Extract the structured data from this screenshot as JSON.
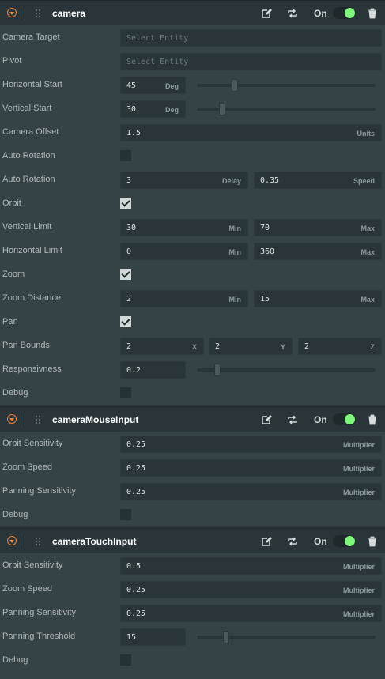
{
  "header_common": {
    "on_label": "On"
  },
  "camera": {
    "title": "camera",
    "camera_target": {
      "label": "Camera Target",
      "placeholder": "Select Entity"
    },
    "pivot": {
      "label": "Pivot",
      "placeholder": "Select Entity"
    },
    "horizontal_start": {
      "label": "Horizontal Start",
      "value": "45",
      "suffix": "Deg",
      "slider": 0.2
    },
    "vertical_start": {
      "label": "Vertical Start",
      "value": "30",
      "suffix": "Deg",
      "slider": 0.13
    },
    "camera_offset": {
      "label": "Camera Offset",
      "value": "1.5",
      "suffix": "Units"
    },
    "auto_rotation_toggle": {
      "label": "Auto Rotation",
      "checked": false
    },
    "auto_rotation": {
      "label": "Auto Rotation",
      "delay": "3",
      "delay_suffix": "Delay",
      "speed": "0.35",
      "speed_suffix": "Speed"
    },
    "orbit": {
      "label": "Orbit",
      "checked": true
    },
    "vertical_limit": {
      "label": "Vertical Limit",
      "min": "30",
      "min_suffix": "Min",
      "max": "70",
      "max_suffix": "Max"
    },
    "horizontal_limit": {
      "label": "Horizontal Limit",
      "min": "0",
      "min_suffix": "Min",
      "max": "360",
      "max_suffix": "Max"
    },
    "zoom": {
      "label": "Zoom",
      "checked": true
    },
    "zoom_distance": {
      "label": "Zoom Distance",
      "min": "2",
      "min_suffix": "Min",
      "max": "15",
      "max_suffix": "Max"
    },
    "pan": {
      "label": "Pan",
      "checked": true
    },
    "pan_bounds": {
      "label": "Pan Bounds",
      "x": "2",
      "x_suffix": "X",
      "y": "2",
      "y_suffix": "Y",
      "z": "2",
      "z_suffix": "Z"
    },
    "responsivness": {
      "label": "Responsivness",
      "value": "0.2",
      "slider": 0.1
    },
    "debug": {
      "label": "Debug",
      "checked": false
    }
  },
  "mouse_input": {
    "title": "cameraMouseInput",
    "orbit_sensitivity": {
      "label": "Orbit Sensitivity",
      "value": "0.25",
      "suffix": "Multiplier"
    },
    "zoom_speed": {
      "label": "Zoom Speed",
      "value": "0.25",
      "suffix": "Multiplier"
    },
    "panning_sensitivity": {
      "label": "Panning Sensitivity",
      "value": "0.25",
      "suffix": "Multiplier"
    },
    "debug": {
      "label": "Debug",
      "checked": false
    }
  },
  "touch_input": {
    "title": "cameraTouchInput",
    "orbit_sensitivity": {
      "label": "Orbit Sensitivity",
      "value": "0.5",
      "suffix": "Multiplier"
    },
    "zoom_speed": {
      "label": "Zoom Speed",
      "value": "0.25",
      "suffix": "Multiplier"
    },
    "panning_sensitivity": {
      "label": "Panning Sensitivity",
      "value": "0.25",
      "suffix": "Multiplier"
    },
    "panning_threshold": {
      "label": "Panning Threshold",
      "value": "15",
      "slider": 0.15
    },
    "debug": {
      "label": "Debug",
      "checked": false
    }
  }
}
